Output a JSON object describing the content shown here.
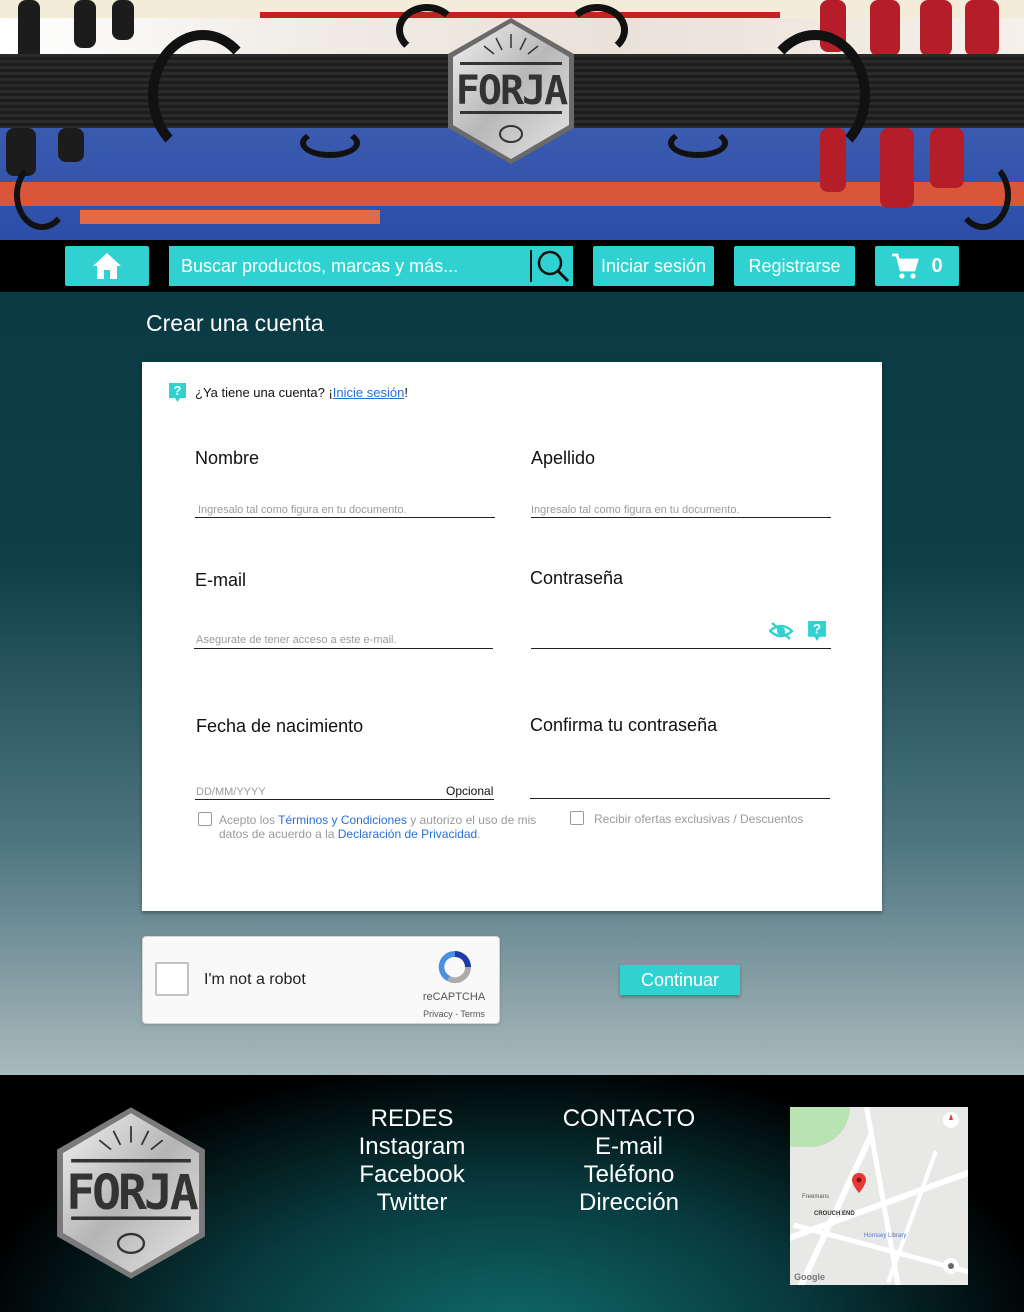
{
  "brand": {
    "name": "FORJA"
  },
  "nav": {
    "search_placeholder": "Buscar productos, marcas y más...",
    "login_label": "Iniciar sesión",
    "register_label": "Registrarse",
    "cart_count": "0",
    "icons": {
      "home": "home-icon",
      "search": "search-icon",
      "cart": "cart-icon"
    }
  },
  "form": {
    "title": "Crear una cuenta",
    "hint_prefix": "¿Ya tiene una cuenta? ¡",
    "hint_link": "Inicie sesión",
    "hint_suffix": "!",
    "fields": {
      "first_name": {
        "label": "Nombre",
        "placeholder": "Ingresalo tal como figura en tu documento."
      },
      "last_name": {
        "label": "Apellido",
        "placeholder": "Ingresalo tal como figura en tu documento."
      },
      "email": {
        "label": "E-mail",
        "placeholder": "Asegurate de tener acceso a este e-mail."
      },
      "password": {
        "label": "Contraseña",
        "placeholder": ""
      },
      "birthdate": {
        "label": "Fecha de nacimiento",
        "placeholder": "DD/MM/YYYY",
        "optional": "Opcional"
      },
      "confirm_password": {
        "label": "Confirma tu contraseña",
        "placeholder": ""
      }
    },
    "terms": {
      "part1": "Acepto los ",
      "link1": "Términos y Condiciones",
      "part2": " y autorizo el uso de mis",
      "part3": "datos de acuerdo a la ",
      "link2": "Declaración de Privacidad",
      "part4": "."
    },
    "offers": "Recibir ofertas exclusivas / Descuentos",
    "captcha": {
      "label": "I'm not a robot",
      "brand": "reCAPTCHA",
      "links": "Privacy - Terms"
    },
    "submit": "Continuar"
  },
  "footer": {
    "social": {
      "title": "REDES",
      "items": [
        "Instagram",
        "Facebook",
        "Twitter"
      ]
    },
    "contact": {
      "title": "CONTACTO",
      "items": [
        "E-mail",
        "Teléfono",
        "Dirección"
      ]
    },
    "map": {
      "labels": [
        "Freemans",
        "CROUCH END",
        "Hornsey Library",
        "Google"
      ]
    }
  },
  "colors": {
    "accent": "#2fd2d0",
    "link": "#2a6fd6",
    "page_bg": "#0a3a44"
  }
}
